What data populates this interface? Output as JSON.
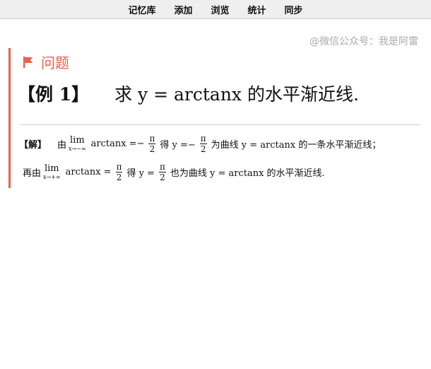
{
  "nav": {
    "items": [
      "记忆库",
      "添加",
      "浏览",
      "统计",
      "同步"
    ]
  },
  "watermark": "@微信公众号：我是阿雷",
  "question": {
    "title": "问题",
    "tag": "【例 1】",
    "text": "求 y = arctanx 的水平渐近线."
  },
  "solution": {
    "tag": "【解】",
    "line1": {
      "pre": "由",
      "lim_word": "lim",
      "lim_sub": "x→−∞",
      "expr": "arctanx =−",
      "frac_num": "π",
      "frac_den": "2",
      "mid": "得 y =−",
      "frac2_num": "π",
      "frac2_den": "2",
      "post": "为曲线 y = arctanx 的一条水平渐近线；"
    },
    "line2": {
      "pre": "再由",
      "lim_word": "lim",
      "lim_sub": "x→+∞",
      "expr": "arctanx =",
      "frac_num": "π",
      "frac_den": "2",
      "mid": "得 y =",
      "frac2_num": "π",
      "frac2_den": "2",
      "post": "也为曲线 y = arctanx 的水平渐近线."
    }
  },
  "colors": {
    "accent": "#e8604c",
    "topbar": "#efefef"
  }
}
